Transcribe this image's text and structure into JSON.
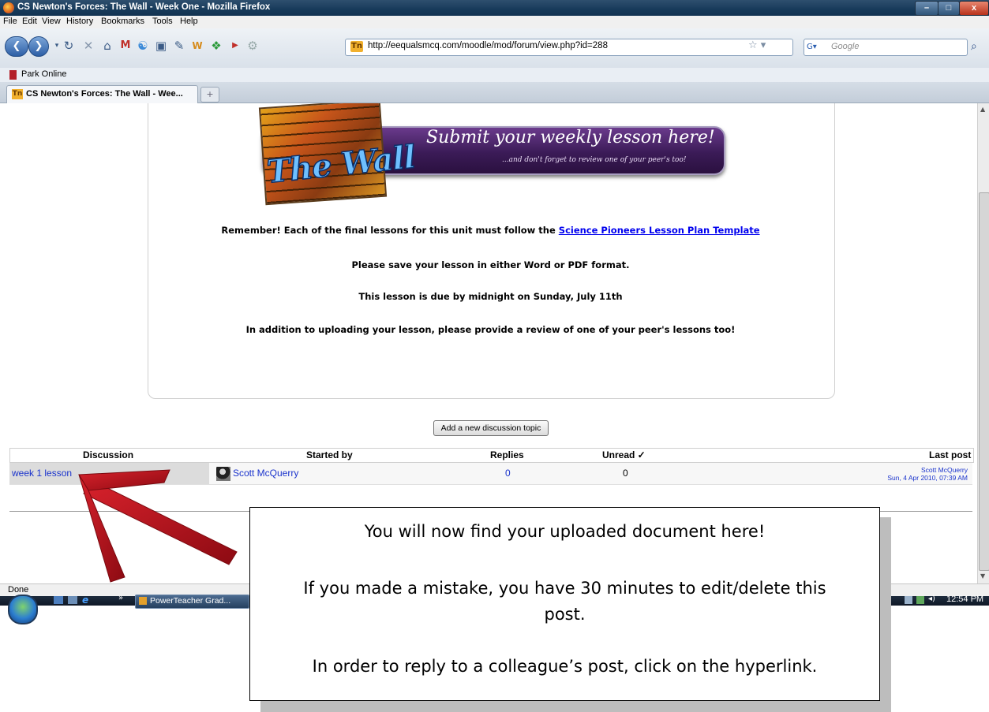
{
  "window": {
    "title": "CS Newton's Forces: The Wall - Week One - Mozilla Firefox",
    "controls": {
      "minimize": "–",
      "maximize": "□",
      "close": "x"
    }
  },
  "menu": [
    "File",
    "Edit",
    "View",
    "History",
    "Bookmarks",
    "Tools",
    "Help"
  ],
  "toolbar": {
    "url": "http://eequalsmcq.com/moodle/mod/forum/view.php?id=288",
    "search_placeholder": "Google",
    "favicon_text": "Tn"
  },
  "bookmarks": {
    "item": "Park Online"
  },
  "tabs": [
    {
      "label": "CS Newton's Forces: The Wall - Wee..."
    }
  ],
  "banner": {
    "wall_text": "The Wall",
    "main_text": "Submit your weekly lesson here!",
    "sub_text": "...and don't forget to review one of your peer's too!"
  },
  "intro": {
    "p1_prefix": "Remember! Each of the final lessons for this unit must follow the ",
    "p1_link": "Science Pioneers Lesson Plan Template",
    "p2": "Please save your lesson in either Word or PDF format.",
    "p3": "This lesson is due by midnight on Sunday, July 11th",
    "p4": "In addition to uploading your lesson, please provide a review of one of your peer's lessons too!"
  },
  "add_topic_button": "Add a new discussion topic",
  "table": {
    "headers": {
      "discussion": "Discussion",
      "started_by": "Started by",
      "replies": "Replies",
      "unread": "Unread ✓",
      "last_post": "Last post"
    },
    "rows": [
      {
        "discussion": "week 1 lesson",
        "started_by": "Scott McQuerry",
        "replies": "0",
        "unread": "0",
        "last_post_author": "Scott McQuerry",
        "last_post_date": "Sun, 4 Apr 2010, 07:39 AM"
      }
    ]
  },
  "status": "Done",
  "taskbar": {
    "item": "PowerTeacher Grad...",
    "time": "12:54 PM"
  },
  "callout": {
    "line1": "You will now find your uploaded document here!",
    "line2a": "If you made a mistake, you have 30 minutes to edit/delete this",
    "line2b": "post.",
    "line3": "In order to reply to a colleague’s post, click on the hyperlink."
  },
  "colors": {
    "link": "#1a33cc",
    "arrow": "#b0101a",
    "banner": "#3b1b57"
  }
}
